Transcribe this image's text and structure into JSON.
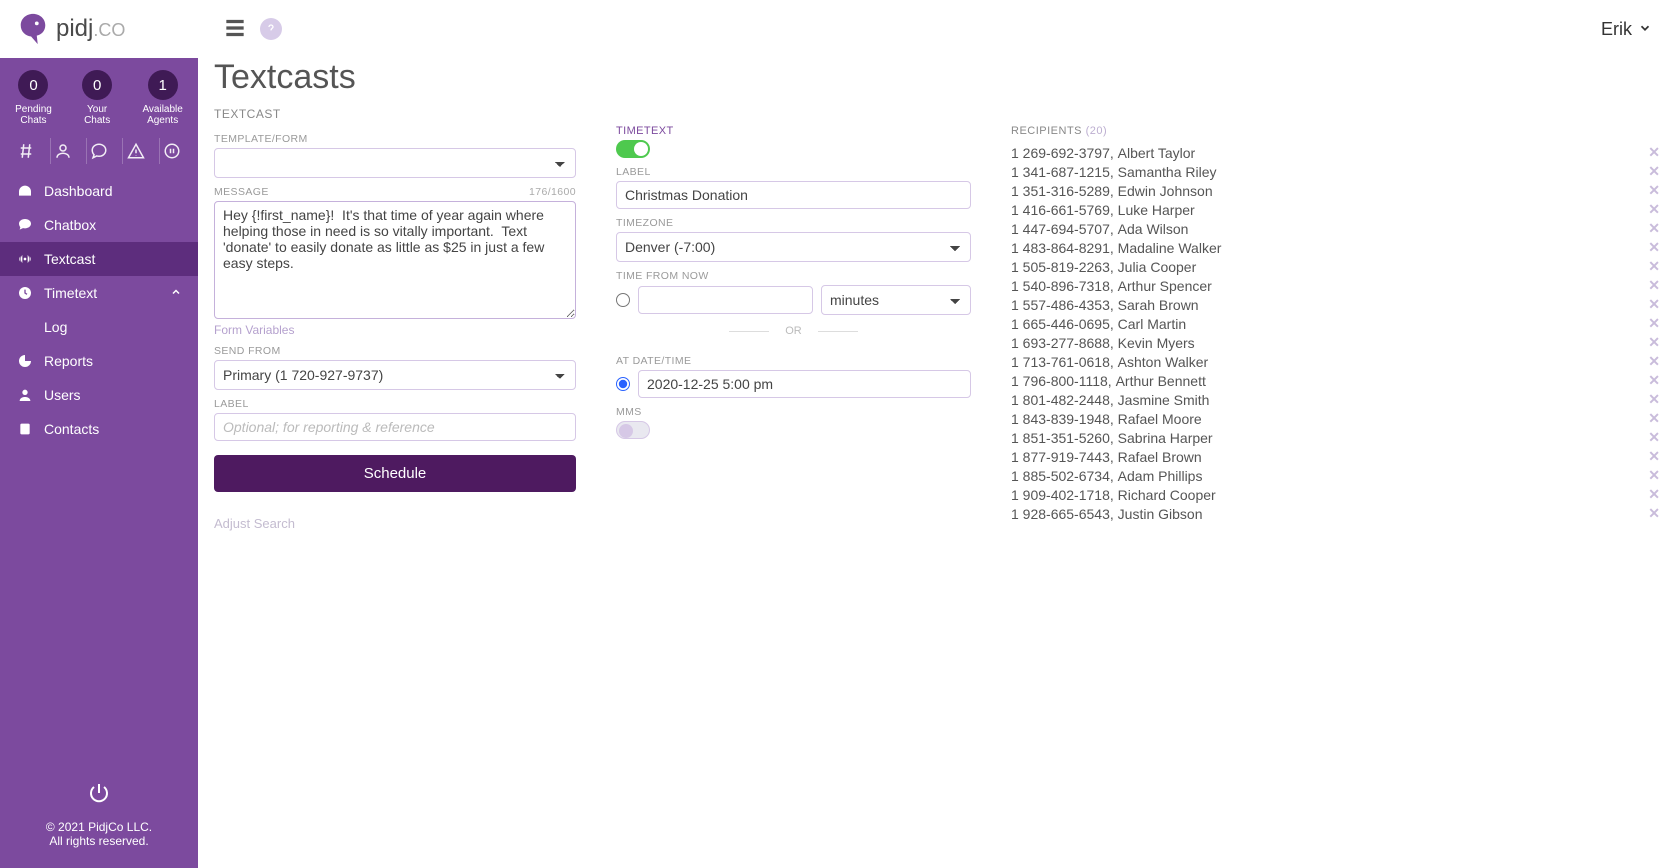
{
  "logo": {
    "brand": "pidj",
    "suffix": ".CO"
  },
  "stats": [
    {
      "value": "0",
      "label": "Pending\nChats"
    },
    {
      "value": "0",
      "label": "Your\nChats"
    },
    {
      "value": "1",
      "label": "Available\nAgents"
    }
  ],
  "nav": [
    {
      "label": "Dashboard"
    },
    {
      "label": "Chatbox"
    },
    {
      "label": "Textcast"
    },
    {
      "label": "Timetext"
    },
    {
      "label": "Log"
    },
    {
      "label": "Reports"
    },
    {
      "label": "Users"
    },
    {
      "label": "Contacts"
    }
  ],
  "footer": {
    "line1": "© 2021 PidjCo LLC.",
    "line2": "All rights reserved."
  },
  "topbar": {
    "user": "Erik"
  },
  "page": {
    "title": "Textcasts",
    "section": "TEXTCAST",
    "labels": {
      "template": "TEMPLATE/FORM",
      "message": "MESSAGE",
      "msg_count": "176/1600",
      "form_vars": "Form Variables",
      "send_from": "SEND FROM",
      "label": "LABEL",
      "label_placeholder": "Optional; for reporting & reference",
      "schedule_btn": "Schedule",
      "adjust_search": "Adjust Search"
    },
    "message_value": "Hey {!first_name}!  It's that time of year again where helping those in need is so vitally important.  Text 'donate' to easily donate as little as $25 in just a few easy steps.",
    "send_from_value": "Primary (1 720-927-9737)"
  },
  "timetext": {
    "heading": "TIMETEXT",
    "labels": {
      "label": "LABEL",
      "timezone": "TIMEZONE",
      "time_from_now": "TIME FROM NOW",
      "unit": "minutes",
      "or": "OR",
      "at": "AT DATE/TIME",
      "mms": "MMS"
    },
    "label_value": "Christmas Donation",
    "timezone_value": "Denver (-7:00)",
    "datetime_value": "2020-12-25 5:00 pm"
  },
  "recipients": {
    "heading": "RECIPIENTS",
    "count": "(20)",
    "items": [
      {
        "phone": "1 269-692-3797",
        "name": "Albert Taylor"
      },
      {
        "phone": "1 341-687-1215",
        "name": "Samantha Riley"
      },
      {
        "phone": "1 351-316-5289",
        "name": "Edwin Johnson"
      },
      {
        "phone": "1 416-661-5769",
        "name": "Luke Harper"
      },
      {
        "phone": "1 447-694-5707",
        "name": "Ada Wilson"
      },
      {
        "phone": "1 483-864-8291",
        "name": "Madaline Walker"
      },
      {
        "phone": "1 505-819-2263",
        "name": "Julia Cooper"
      },
      {
        "phone": "1 540-896-7318",
        "name": "Arthur Spencer"
      },
      {
        "phone": "1 557-486-4353",
        "name": "Sarah Brown"
      },
      {
        "phone": "1 665-446-0695",
        "name": "Carl Martin"
      },
      {
        "phone": "1 693-277-8688",
        "name": "Kevin Myers"
      },
      {
        "phone": "1 713-761-0618",
        "name": "Ashton Walker"
      },
      {
        "phone": "1 796-800-1118",
        "name": "Arthur Bennett"
      },
      {
        "phone": "1 801-482-2448",
        "name": "Jasmine Smith"
      },
      {
        "phone": "1 843-839-1948",
        "name": "Rafael Moore"
      },
      {
        "phone": "1 851-351-5260",
        "name": "Sabrina Harper"
      },
      {
        "phone": "1 877-919-7443",
        "name": "Rafael Brown"
      },
      {
        "phone": "1 885-502-6734",
        "name": "Adam Phillips"
      },
      {
        "phone": "1 909-402-1718",
        "name": "Richard Cooper"
      },
      {
        "phone": "1 928-665-6543",
        "name": "Justin Gibson"
      }
    ]
  }
}
